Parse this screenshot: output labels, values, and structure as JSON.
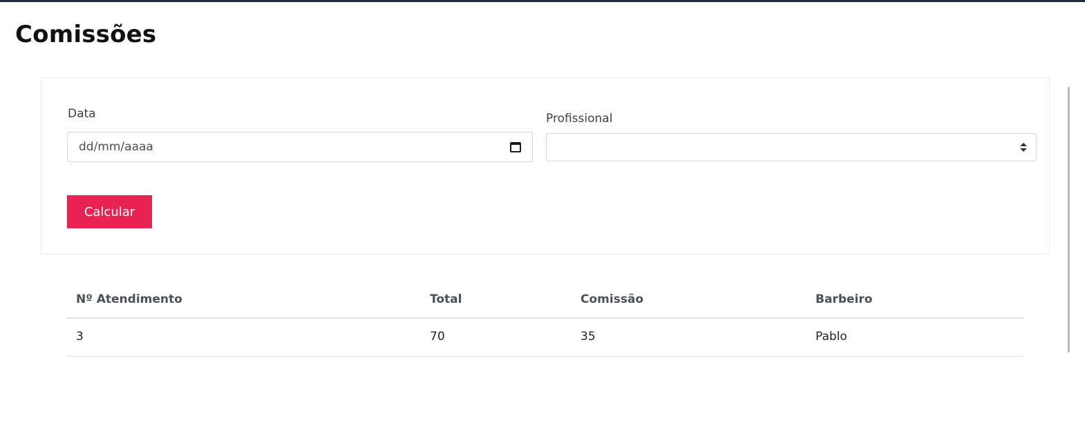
{
  "page": {
    "title": "Comissões"
  },
  "filters": {
    "date_label": "Data",
    "date_placeholder": "dd/mm/aaaa",
    "professional_label": "Profissional",
    "professional_value": "",
    "calculate_label": "Calcular"
  },
  "table": {
    "headers": [
      "Nº Atendimento",
      "Total",
      "Comissão",
      "Barbeiro"
    ],
    "rows": [
      [
        "3",
        "70",
        "35",
        "Pablo"
      ]
    ]
  },
  "colors": {
    "accent": "#e82354",
    "top_bar": "#1f2a3c"
  },
  "icons": {
    "date": "calendar-icon",
    "select": "select-caret-icon"
  }
}
